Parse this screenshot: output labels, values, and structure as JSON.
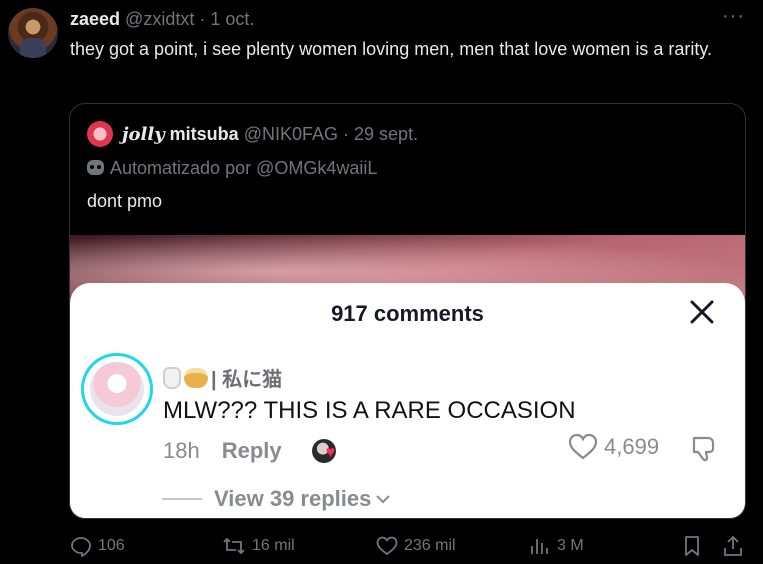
{
  "tweet": {
    "author_name": "zaeed",
    "author_handle": "@zxidtxt",
    "separator": "·",
    "date": "1 oct.",
    "text": "they got a point, i see plenty women loving men, men that love women is a rarity.",
    "more_icon": "more-horizontal-icon"
  },
  "quote": {
    "name_decorated": "𝒋𝒐𝒍𝒍𝒚",
    "name": "mitsuba",
    "handle": "@NIK0FAG",
    "date": "· 29 sept.",
    "automated": "Automatizado por @OMGk4waiiL",
    "text": "dont pmo",
    "media": {
      "sheet_title": "917 comments",
      "comment": {
        "username": "| 私に猫",
        "text": "MLW??? THIS IS A RARE OCCASION",
        "time": "18h",
        "reply_label": "Reply",
        "likes": "4,699",
        "view_replies": "View 39 replies"
      }
    }
  },
  "actions": {
    "replies": "106",
    "reposts": "16 mil",
    "likes": "236 mil",
    "views": "3 M"
  },
  "colors": {
    "background": "#000000",
    "text": "#e7e9ea",
    "muted": "#71767b",
    "accent_ring": "#20d5ec",
    "like_heart": "#fe2c55"
  }
}
